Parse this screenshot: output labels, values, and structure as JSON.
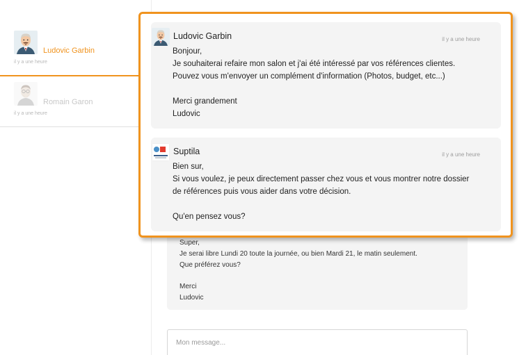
{
  "sidebar": {
    "conversations": [
      {
        "name": "Ludovic Garbin",
        "time": "il y a une heure",
        "active": true,
        "avatar_icon": "man-with-mustache-avatar-icon"
      },
      {
        "name": "Romain Garon",
        "time": "il y a une heure",
        "active": false,
        "avatar_icon": "man-with-glasses-avatar-icon"
      }
    ]
  },
  "callout": {
    "messages": [
      {
        "author": "Ludovic Garbin",
        "time": "il y a une heure",
        "avatar_icon": "man-with-mustache-avatar-icon",
        "lines": [
          "Bonjour,",
          "Je souhaiterai refaire mon salon et j'ai été intéressé par vos références clientes.",
          "Pouvez vous m'envoyer un complément d'information (Photos, budget, etc...)",
          "",
          "Merci grandement",
          "Ludovic"
        ]
      },
      {
        "author": "Suptila",
        "time": "il y a une heure",
        "avatar_icon": "suptila-logo-icon",
        "lines": [
          "Bien sur,",
          "Si vous voulez, je peux directement passer chez vous et vous montrer notre dossier",
          "de références puis vous aider dans votre décision.",
          "",
          "Qu'en pensez vous?"
        ]
      }
    ]
  },
  "thread": {
    "visible_message_lines": [
      "Super,",
      "Je serai libre Lundi 20 toute la journée, ou bien Mardi 21, le matin seulement.",
      "Que préférez vous?",
      "",
      "Merci",
      "Ludovic"
    ]
  },
  "composer": {
    "placeholder": "Mon message..."
  },
  "colors": {
    "accent": "#f0931e",
    "bubble": "#f4f4f4"
  }
}
